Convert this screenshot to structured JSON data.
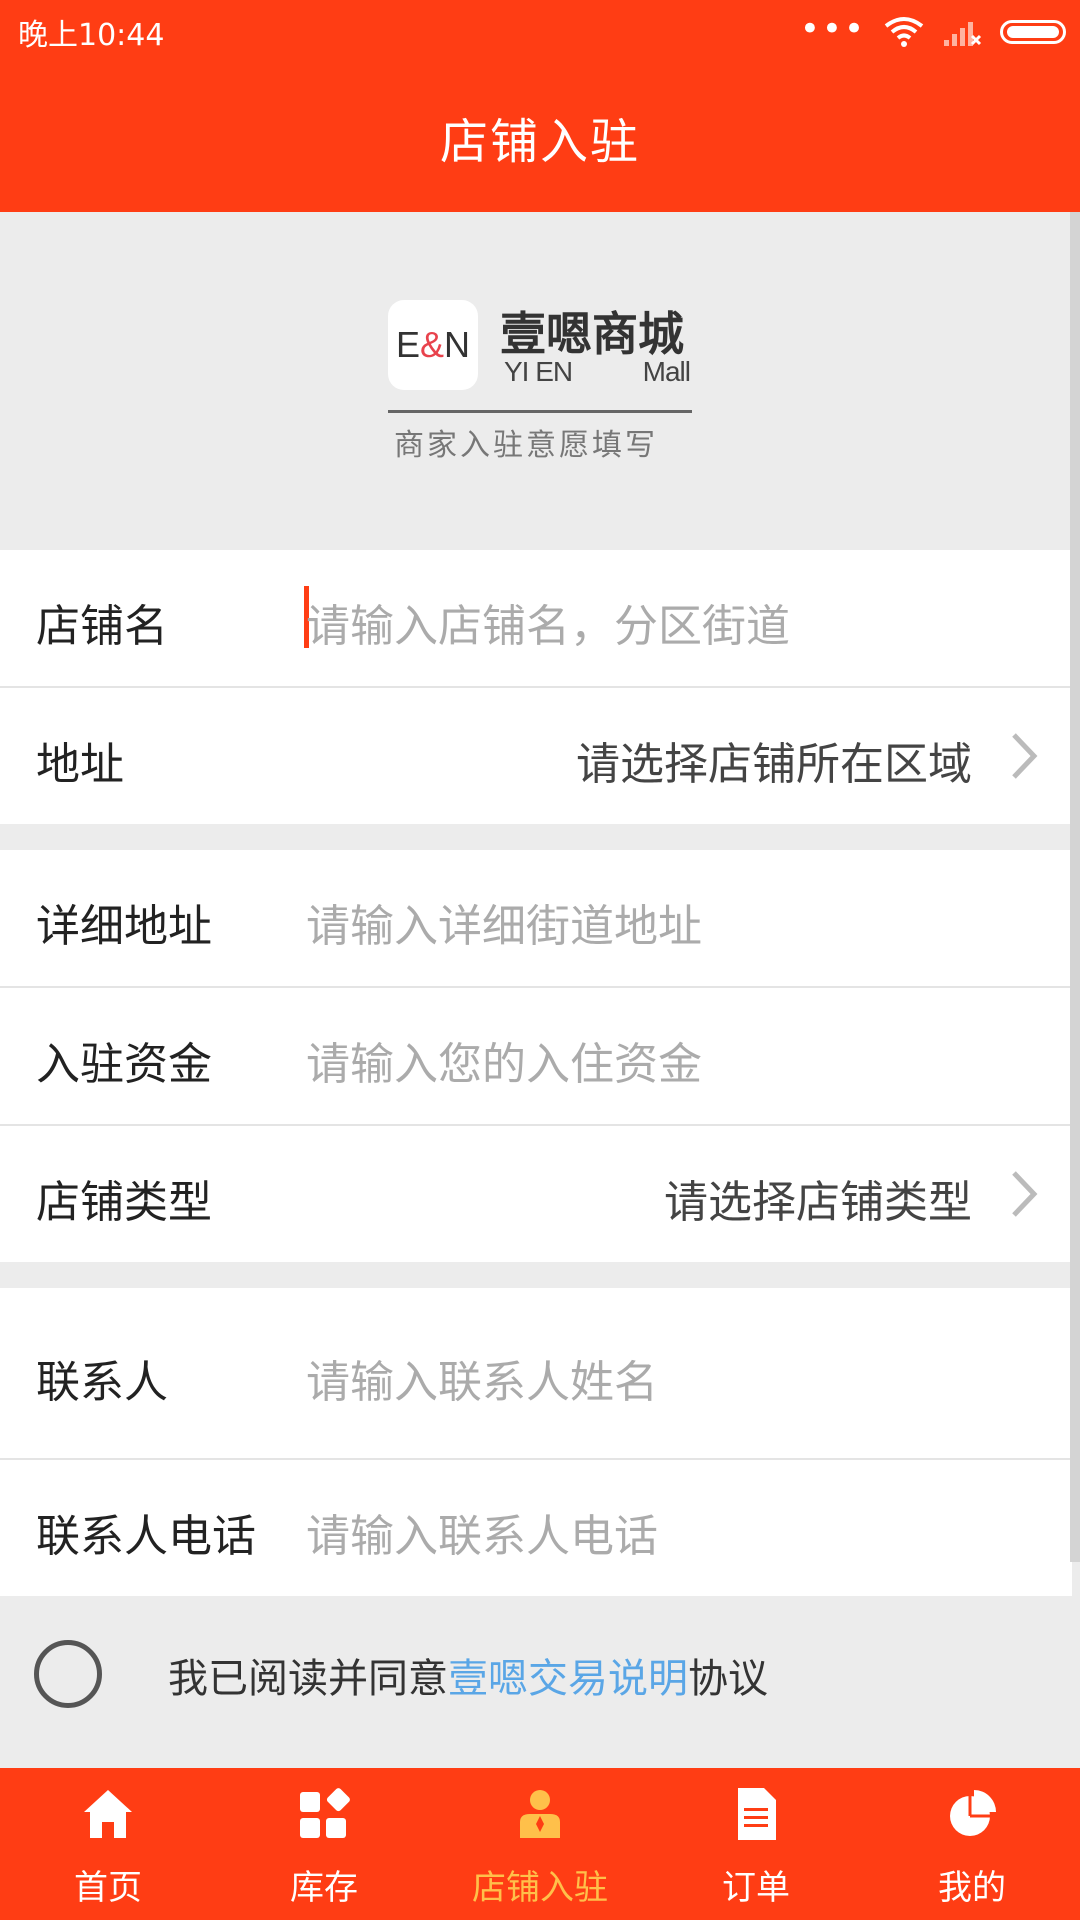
{
  "status": {
    "time": "晚上10:44"
  },
  "header": {
    "title": "店铺入驻"
  },
  "banner": {
    "logo_left": "E",
    "logo_amp": "&",
    "logo_right": "N",
    "brand_cn": "壹嗯商城",
    "brand_en_1": "YI EN",
    "brand_en_2": "Mall",
    "subtitle": "商家入驻意愿填写"
  },
  "form": {
    "shop_name": {
      "label": "店铺名",
      "placeholder": "请输入店铺名，分区街道"
    },
    "address": {
      "label": "地址",
      "value": "请选择店铺所在区域"
    },
    "detail_address": {
      "label": "详细地址",
      "placeholder": "请输入详细街道地址"
    },
    "funds": {
      "label": "入驻资金",
      "placeholder": "请输入您的入住资金"
    },
    "shop_type": {
      "label": "店铺类型",
      "value": "请选择店铺类型"
    },
    "contact": {
      "label": "联系人",
      "placeholder": "请输入联系人姓名"
    },
    "phone": {
      "label": "联系人电话",
      "placeholder": "请输入联系人电话"
    }
  },
  "agreement": {
    "prefix": "我已阅读并同意",
    "link": "壹嗯交易说明",
    "suffix": "协议"
  },
  "tabs": [
    {
      "label": "首页",
      "icon": "home-icon"
    },
    {
      "label": "库存",
      "icon": "grid-icon"
    },
    {
      "label": "店铺入驻",
      "icon": "person-icon",
      "active": true
    },
    {
      "label": "订单",
      "icon": "document-icon"
    },
    {
      "label": "我的",
      "icon": "pie-icon"
    }
  ],
  "colors": {
    "primary": "#ff3d14",
    "active_tab": "#ffc04a",
    "link": "#5aa6e6"
  }
}
